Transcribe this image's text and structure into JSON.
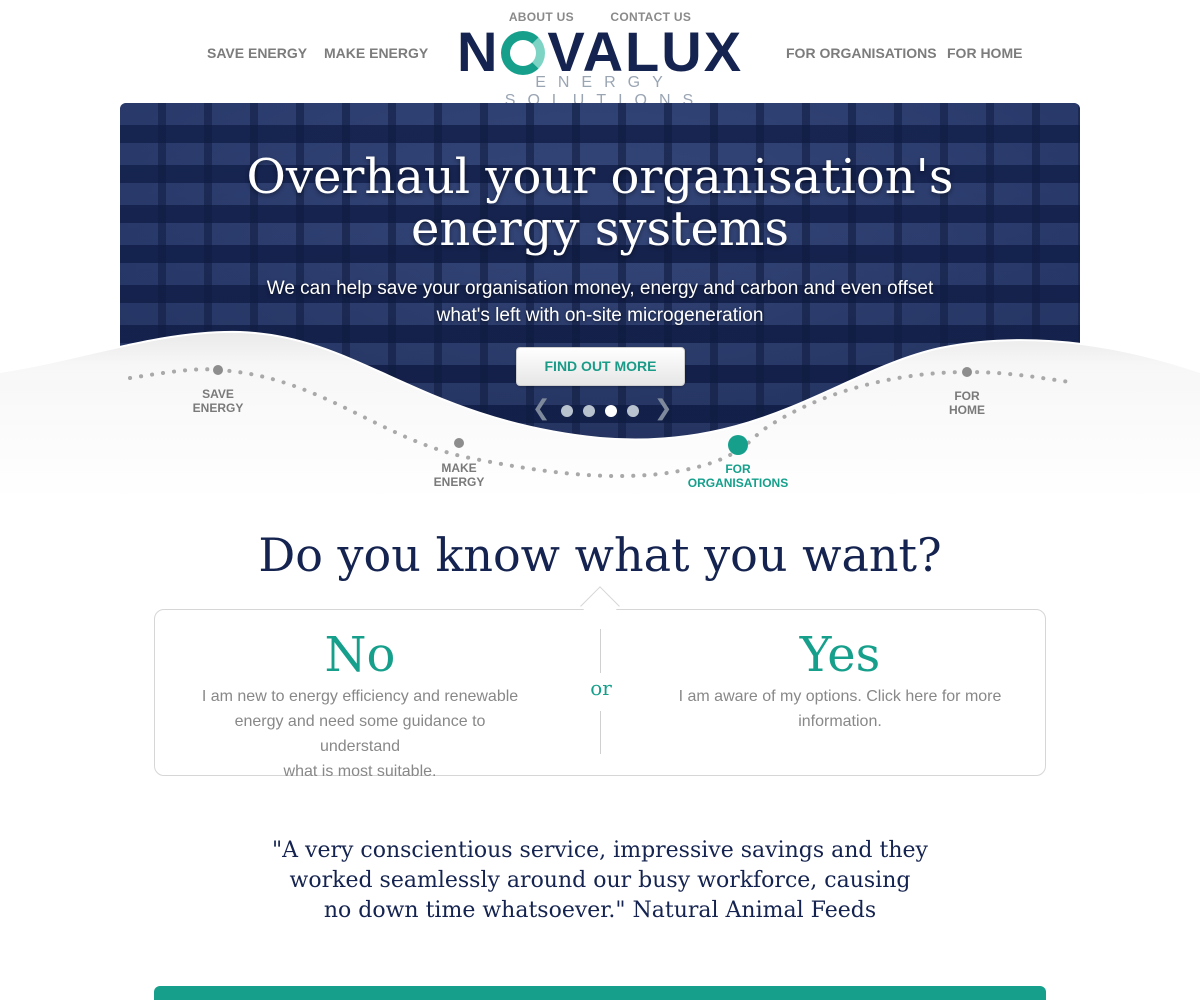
{
  "header": {
    "top_links": [
      "ABOUT US",
      "CONTACT US"
    ],
    "nav_left": [
      "SAVE ENERGY",
      "MAKE ENERGY"
    ],
    "nav_right": [
      "FOR ORGANISATIONS",
      "FOR HOME"
    ],
    "logo_name": "NOVALUX",
    "logo_tagline": "ENERGY SOLUTIONS"
  },
  "hero": {
    "title_line1": "Overhaul your organisation's",
    "title_line2": "energy systems",
    "subtitle_line1": "We can help save your organisation money, energy and carbon and even offset",
    "subtitle_line2": "what's left with on-site microgeneration",
    "cta_label": "FIND OUT MORE",
    "prev_icon": "chevron-left-icon",
    "next_icon": "chevron-right-icon",
    "slide_count": 4,
    "active_slide": 3
  },
  "wave_nav": {
    "items": [
      {
        "line1": "SAVE",
        "line2": "ENERGY"
      },
      {
        "line1": "MAKE",
        "line2": "ENERGY"
      },
      {
        "line1": "FOR",
        "line2": "ORGANISATIONS"
      },
      {
        "line1": "FOR",
        "line2": "HOME"
      }
    ],
    "active_index": 2
  },
  "question": {
    "title": "Do you know what you want?",
    "or_label": "or",
    "no_title": "No",
    "no_text_line1": "I am new to energy efficiency and renewable",
    "no_text_line2": "energy and need some guidance to understand",
    "no_text_line3": "what is most suitable.",
    "yes_title": "Yes",
    "yes_text_line1": "I am aware of my options. Click here for more",
    "yes_text_line2": "information."
  },
  "testimonial": {
    "line1": "\"A very conscientious service, impressive savings and they",
    "line2": "worked seamlessly around our busy workforce, causing",
    "line3": "no down time whatsoever.\" Natural Animal Feeds"
  },
  "colors": {
    "navy": "#14234f",
    "teal": "#16a08c",
    "grey_text": "#7c7c7c"
  }
}
